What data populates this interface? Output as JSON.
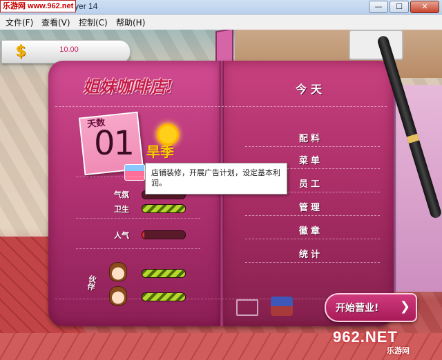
{
  "window": {
    "title": "Adobe Flash Player 14",
    "watermark_top": "乐游网 www.962.net"
  },
  "menubar": {
    "items": [
      "文件(F)",
      "查看(V)",
      "控制(C)",
      "帮助(H)"
    ]
  },
  "hud": {
    "money": "10.00",
    "money_icon": "dollar-icon"
  },
  "book": {
    "shop_title": "姐妹咖啡店!",
    "day_label": "天数",
    "day_number": "01",
    "season": "旱季",
    "tooltip": "店铺装修，开展广告计划，设定基本利润。",
    "stats": [
      {
        "label": "气氛",
        "level": 0.0
      },
      {
        "label": "卫生",
        "level": 1.0
      },
      {
        "label": "人气",
        "level": 0.05
      }
    ],
    "staff_label": "伙伴",
    "staff": [
      {
        "level": 1.0
      },
      {
        "level": 1.0
      }
    ],
    "today_title": "今天",
    "menu": [
      "配料",
      "菜单",
      "员工",
      "管理",
      "徽章",
      "统计"
    ],
    "start_button": "开始营业!"
  },
  "watermark_bottom": {
    "brand": "962.NET",
    "sub": "乐游网"
  },
  "colors": {
    "book_pink": "#b73576",
    "bar_green": "#b4d82b",
    "bar_red": "#d9302a",
    "money_text": "#c0185a"
  }
}
